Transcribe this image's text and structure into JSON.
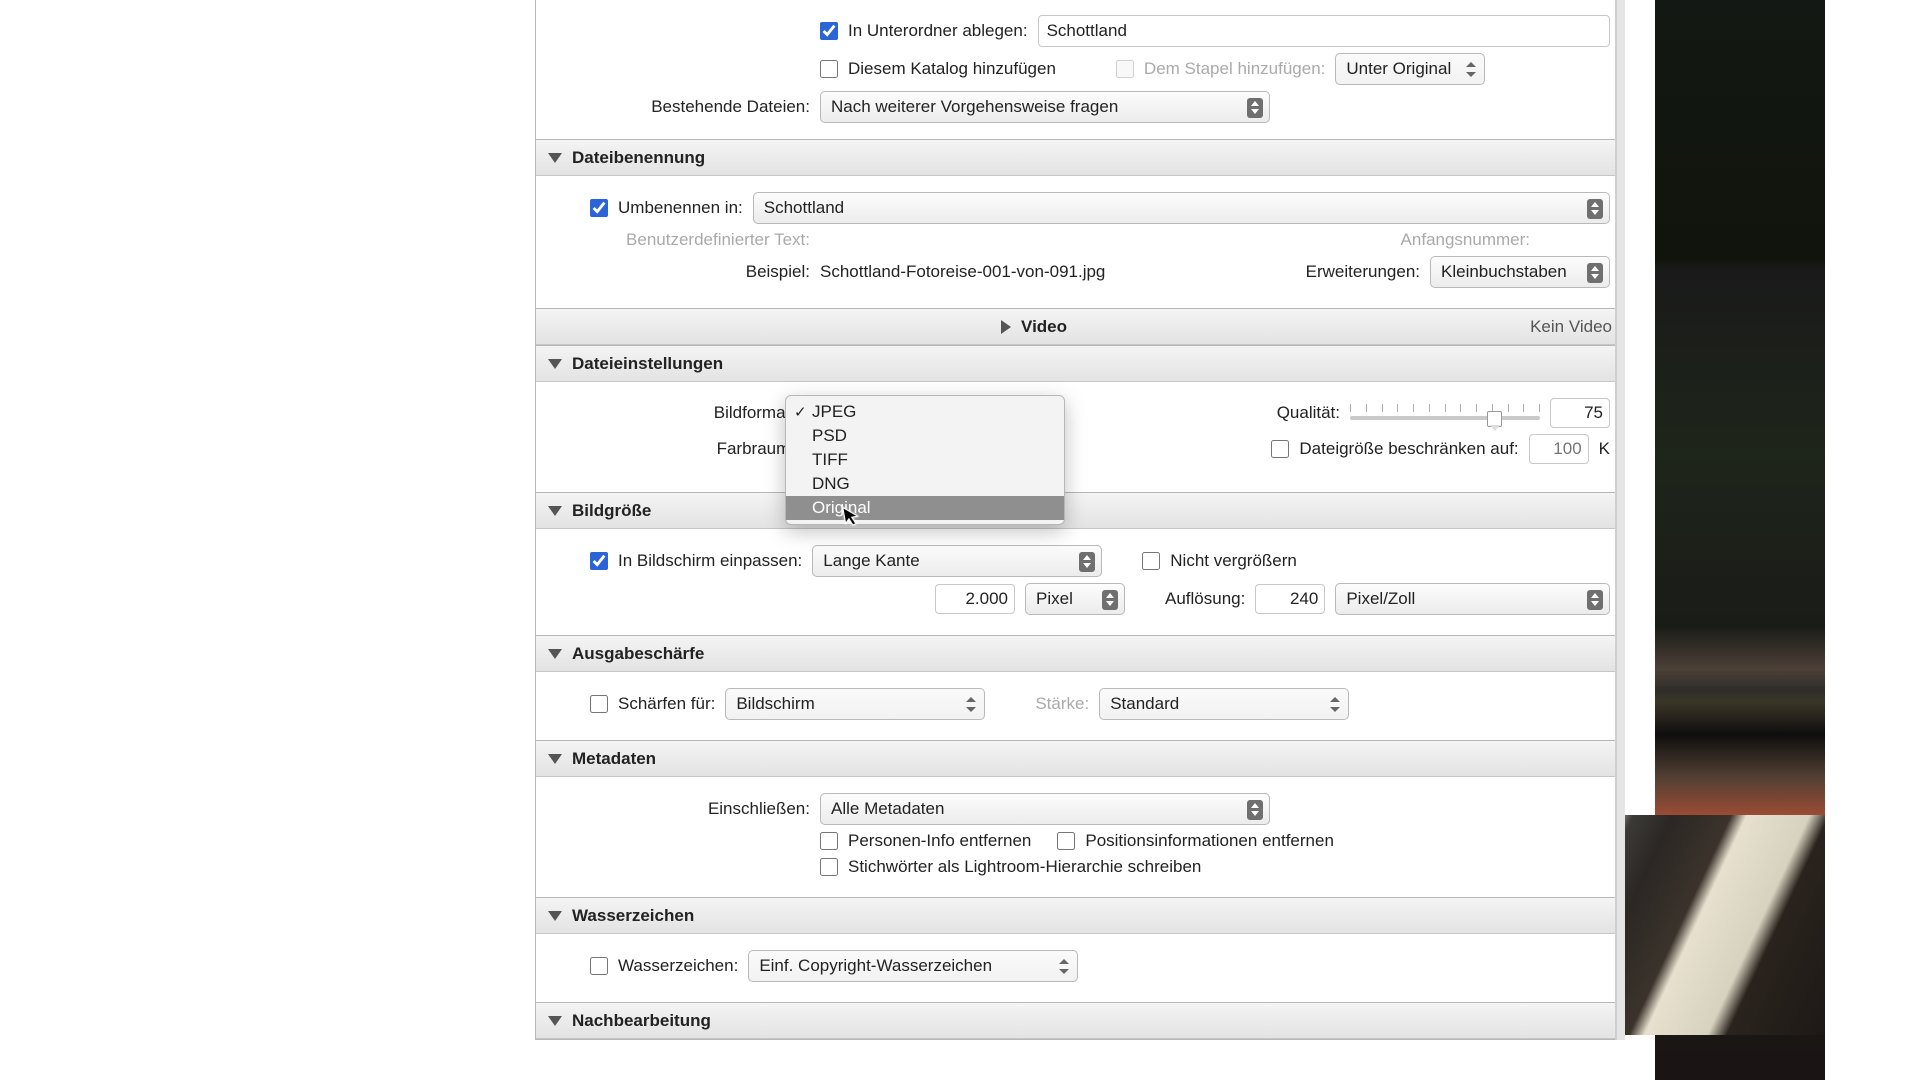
{
  "top": {
    "subfolder_label": "In Unterordner ablegen:",
    "subfolder_value": "Schottland",
    "add_catalog": "Diesem Katalog hinzufügen",
    "add_stack": "Dem Stapel hinzufügen:",
    "stack_select": "Unter Original",
    "existing_label": "Bestehende Dateien:",
    "existing_select": "Nach weiterer Vorgehensweise fragen"
  },
  "naming": {
    "title": "Dateibenennung",
    "rename_label": "Umbenennen in:",
    "rename_value": "Schottland",
    "custom_text": "Benutzerdefinierter Text:",
    "start_num": "Anfangsnummer:",
    "example_label": "Beispiel:",
    "example_value": "Schottland-Fotoreise-001-von-091.jpg",
    "ext_label": "Erweiterungen:",
    "ext_value": "Kleinbuchstaben"
  },
  "video": {
    "title": "Video",
    "status": "Kein Video"
  },
  "filesettings": {
    "title": "Dateieinstellungen",
    "format_label": "Bildformat:",
    "colorspace_label": "Farbraum:",
    "quality_label": "Qualität:",
    "quality_value": "75",
    "limit_label": "Dateigröße beschränken auf:",
    "limit_placeholder": "100",
    "limit_unit": "K",
    "options": {
      "o1": "JPEG",
      "o2": "PSD",
      "o3": "TIFF",
      "o4": "DNG",
      "o5": "Original"
    }
  },
  "sizing": {
    "title": "Bildgröße",
    "fit_label": "In Bildschirm einpassen:",
    "fit_value": "Lange Kante",
    "no_enlarge": "Nicht vergrößern",
    "dim_value": "2.000",
    "dim_unit": "Pixel",
    "res_label": "Auflösung:",
    "res_value": "240",
    "res_unit": "Pixel/Zoll"
  },
  "sharpen": {
    "title": "Ausgabeschärfe",
    "for_label": "Schärfen für:",
    "for_value": "Bildschirm",
    "amount_label": "Stärke:",
    "amount_value": "Standard"
  },
  "metadata": {
    "title": "Metadaten",
    "include_label": "Einschließen:",
    "include_value": "Alle Metadaten",
    "remove_people": "Personen-Info entfernen",
    "remove_location": "Positionsinformationen entfernen",
    "keywords_hierarchy": "Stichwörter als Lightroom-Hierarchie schreiben"
  },
  "watermark": {
    "title": "Wasserzeichen",
    "label": "Wasserzeichen:",
    "value": "Einf. Copyright-Wasserzeichen"
  },
  "post": {
    "title": "Nachbearbeitung"
  }
}
